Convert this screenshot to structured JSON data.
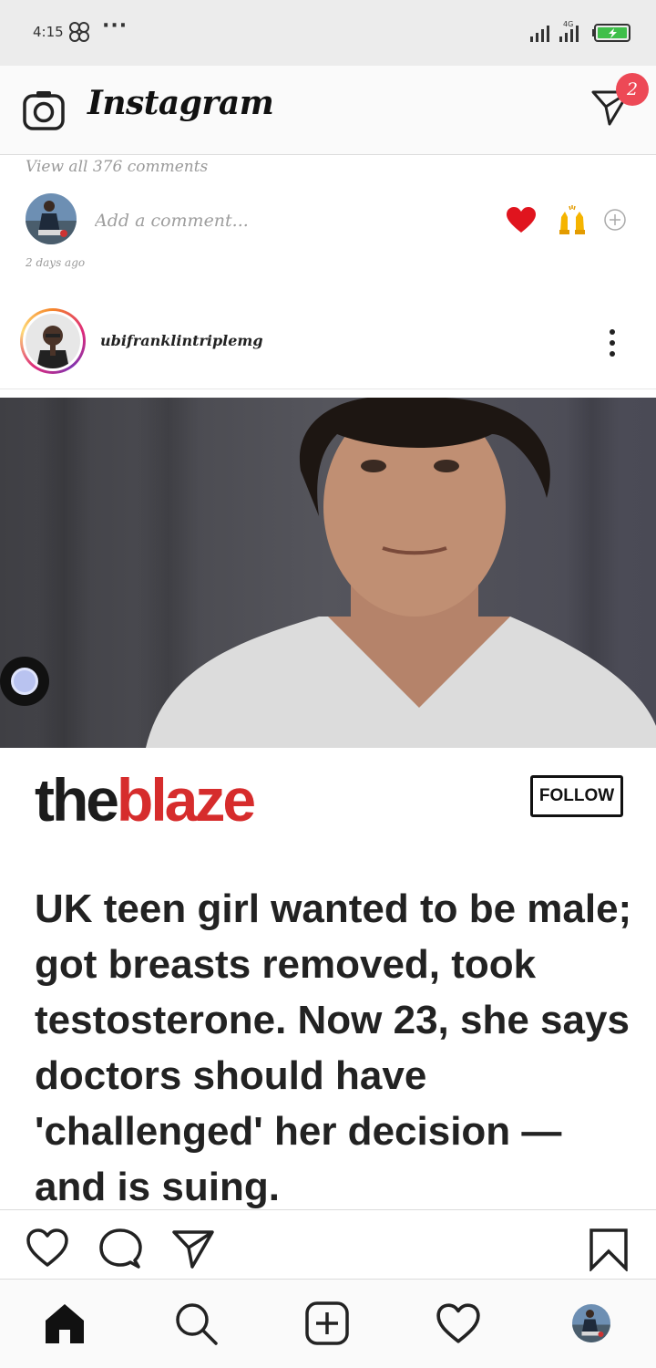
{
  "status_bar": {
    "time": "4:15",
    "network": "4G"
  },
  "header": {
    "app_name": "Instagram",
    "direct_badge_count": "2"
  },
  "comments": {
    "view_all": "View all 376 comments",
    "input_placeholder": "Add a comment...",
    "quick_reactions": [
      "red-heart-emoji",
      "raising-hands-emoji",
      "add-reaction-icon"
    ],
    "timestamp": "2 days ago"
  },
  "post": {
    "username": "ubifranklintriplemg",
    "image": {
      "brand_the": "the",
      "brand_blaze": "blaze",
      "follow_label": "FOLLOW",
      "headline": "UK teen girl wanted to be male; got breasts removed, took testosterone. Now 23, she says doctors should have 'challenged' her decision — and is suing."
    }
  },
  "actions": [
    "heart-icon",
    "comment-icon",
    "share-icon",
    "bookmark-icon"
  ],
  "bottom_nav": [
    "home-icon",
    "search-icon",
    "new-post-icon",
    "activity-heart-icon",
    "profile-avatar"
  ],
  "colors": {
    "badge": "#ed4956",
    "blaze_red": "#d62c2c",
    "story_ring": "#dd2a7b"
  }
}
